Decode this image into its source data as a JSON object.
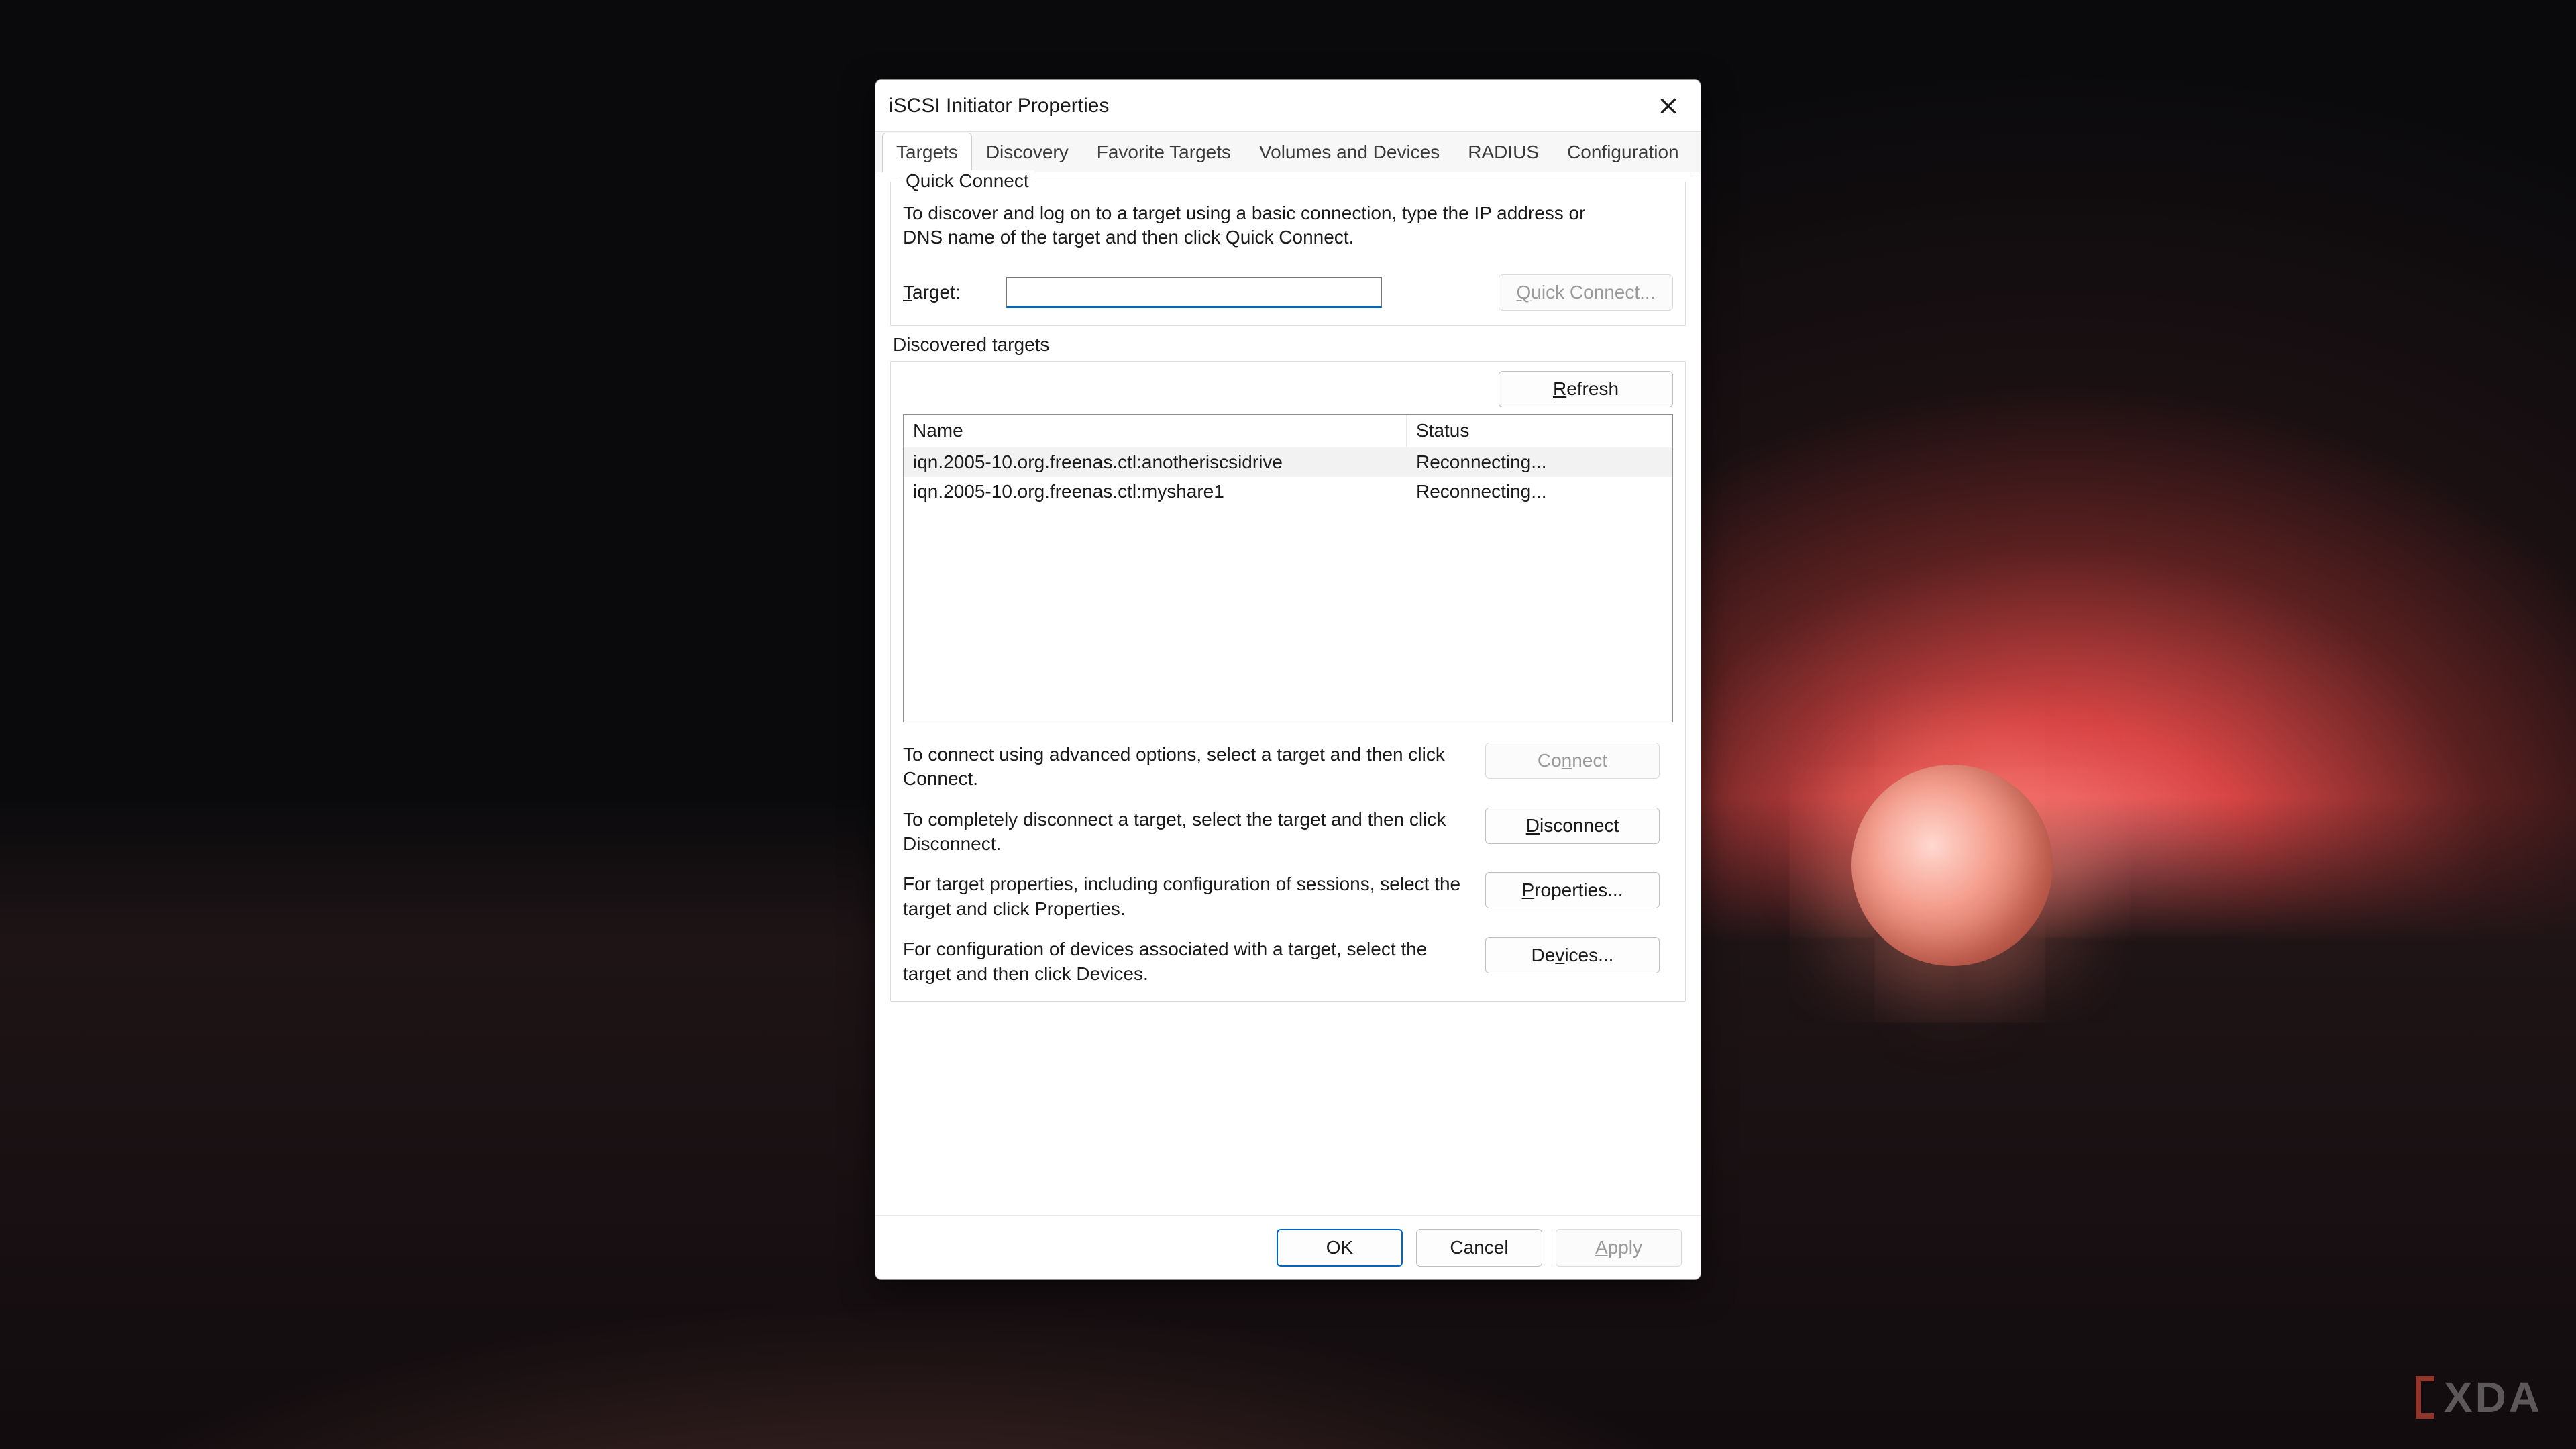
{
  "watermark": "XDA",
  "dialog": {
    "title": "iSCSI Initiator Properties",
    "tabs": [
      "Targets",
      "Discovery",
      "Favorite Targets",
      "Volumes and Devices",
      "RADIUS",
      "Configuration"
    ],
    "active_tab": 0,
    "quick_connect": {
      "legend": "Quick Connect",
      "description": "To discover and log on to a target using a basic connection, type the IP address or DNS name of the target and then click Quick Connect.",
      "target_label": "Target:",
      "target_value": "",
      "button": "Quick Connect..."
    },
    "discovered": {
      "legend": "Discovered targets",
      "refresh": "Refresh",
      "columns": {
        "name": "Name",
        "status": "Status"
      },
      "rows": [
        {
          "name": "iqn.2005-10.org.freenas.ctl:anotheriscsidrive",
          "status": "Reconnecting..."
        },
        {
          "name": "iqn.2005-10.org.freenas.ctl:myshare1",
          "status": "Reconnecting..."
        }
      ],
      "help": {
        "connect_text": "To connect using advanced options, select a target and then click Connect.",
        "connect_btn": "Connect",
        "disconnect_text": "To completely disconnect a target, select the target and then click Disconnect.",
        "disconnect_btn": "Disconnect",
        "properties_text": "For target properties, including configuration of sessions, select the target and click Properties.",
        "properties_btn": "Properties...",
        "devices_text": "For configuration of devices associated with a target, select the target and then click Devices.",
        "devices_btn": "Devices..."
      }
    },
    "footer": {
      "ok": "OK",
      "cancel": "Cancel",
      "apply": "Apply"
    }
  }
}
